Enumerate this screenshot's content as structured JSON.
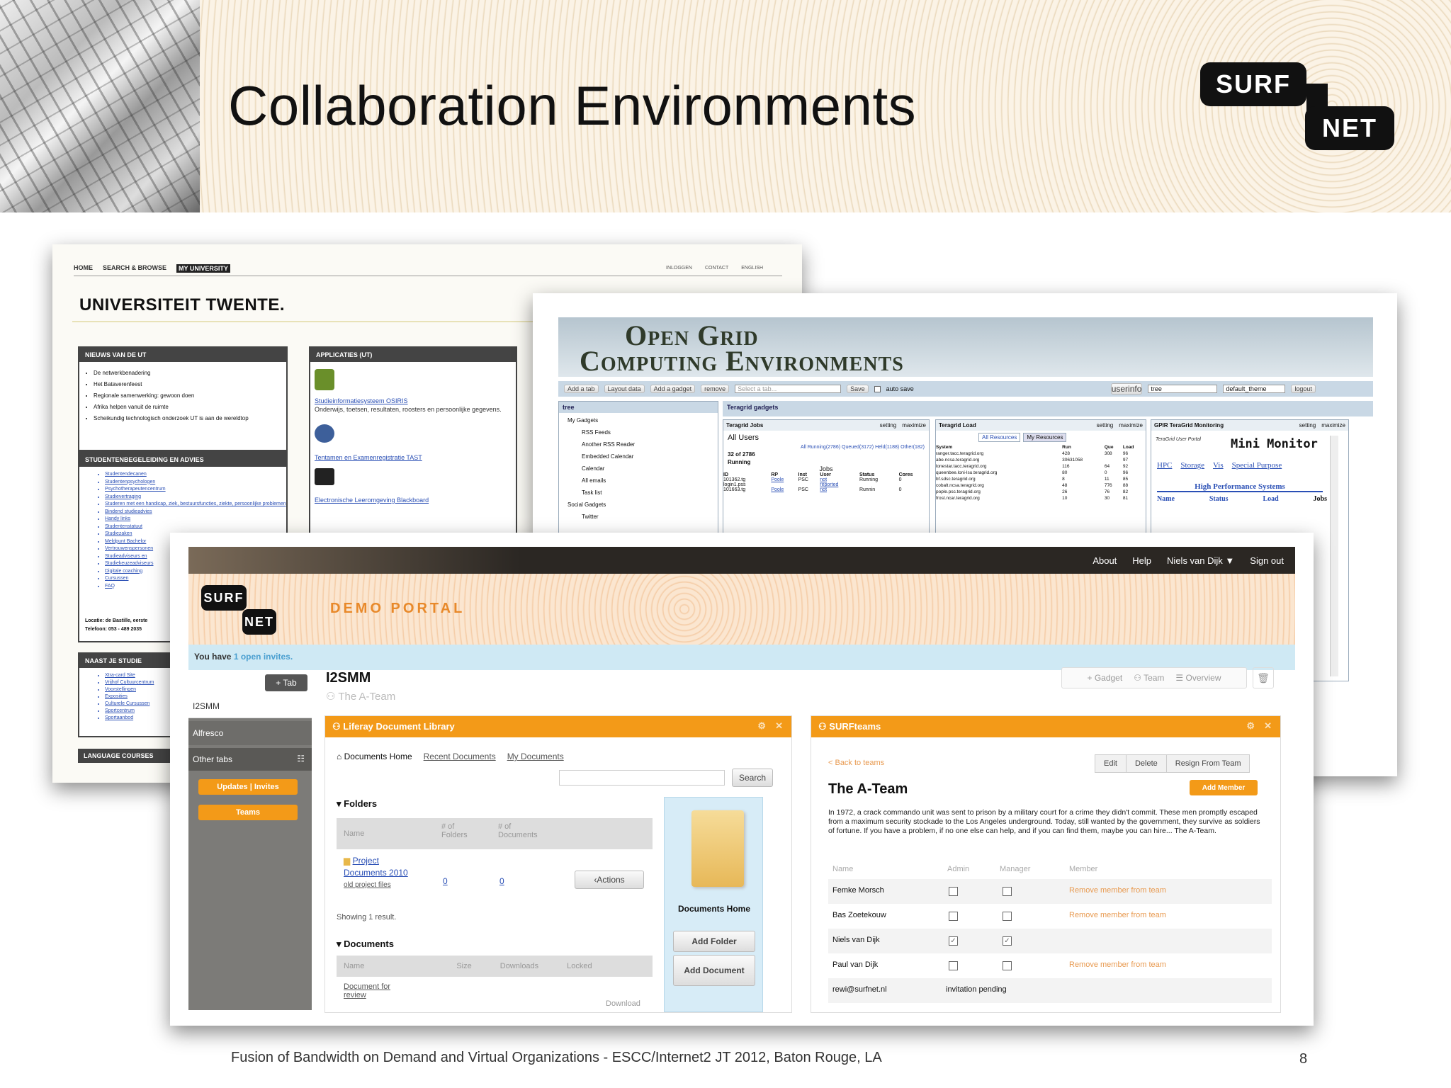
{
  "slide": {
    "title": "Collaboration Environments",
    "footer": "Fusion of Bandwidth on Demand and Virtual Organizations - ESCC/Internet2 JT 2012, Baton Rouge, LA",
    "page_number": "8",
    "logo_top": "SURF",
    "logo_bottom": "NET"
  },
  "twente": {
    "nav": [
      "HOME",
      "SEARCH & BROWSE",
      "MY UNIVERSITY"
    ],
    "nav_right": [
      "INLOGGEN",
      "CONTACT",
      "ENGLISH"
    ],
    "brand": "UNIVERSITEIT TWENTE.",
    "news_title": "NIEUWS VAN DE UT",
    "news": [
      "De netwerkbenadering",
      "Het Bataverenfeest",
      "Regionale samenwerking: gewoon doen",
      "Afrika helpen vanuit de ruimte",
      "Scheikundig technologisch onderzoek UT is aan de wereldtop"
    ],
    "apps_title": "APPLICATIES (UT)",
    "app1_link": "Studieinformatiesysteem OSIRIS",
    "app1_desc": "Onderwijs, toetsen, resultaten, roosters en persoonlijke gegevens.",
    "app2_link": "Tentamen en Examenregistratie TAST",
    "app3_link": "Electronische Leeromgeving Blackboard",
    "study_title": "STUDENTENBEGELEIDING EN ADVIES",
    "study": [
      "Studentendecanen",
      "Studentenpsychologen",
      "Psychotherapeutencentrum",
      "Studievertraging",
      "Studeren met een handicap, ziek, bestuursfuncties, ziekte, persoonlijke problemen",
      "Bindend studieadvies",
      "Handy links",
      "Studentenstatuut",
      "Studiezaken",
      "Meldpunt Bachelor",
      "Vertrouwenspersonen",
      "Studieadviseurs en",
      "Studiekeuzeadviseurs",
      "Digitale coaching",
      "Cursussen",
      "FAQ"
    ],
    "locatie": "Locatie: de Bastille, eerste",
    "telefoon": "Telefoon: 053 - 489 2035",
    "naast_title": "NAAST JE STUDIE",
    "naast": [
      "Xtra-card Site",
      "Vrijhof Cultuurcentrum",
      "Voorstellingen",
      "Exposities",
      "Culturele Cursussen",
      "Sportcentrum",
      "Sportaanbod"
    ],
    "lang_title": "LANGUAGE COURSES"
  },
  "ogce": {
    "brand_line1": "Open Grid",
    "brand_line2": "Computing Environments",
    "toolbar": [
      "Add a tab",
      "Layout data",
      "Add a gadget",
      "remove",
      "Select a tab...",
      "Save",
      "auto save",
      "userinfo",
      "tree",
      "default_theme",
      "logout"
    ],
    "tree_title": "tree",
    "gadgets_title": "Teragrid gadgets",
    "tree": [
      "My Gadgets",
      "RSS Feeds",
      "Another RSS Reader",
      "Embedded Calendar",
      "Calendar",
      "All emails",
      "Task list",
      "Social Gadgets",
      "Twitter"
    ],
    "jobs_title": "Teragrid Jobs",
    "load_title": "Teragrid Load",
    "monitor_title": "GPIR TeraGrid Monitoring",
    "setting": "setting",
    "maximize": "maximize",
    "all_users": "All Users",
    "count": "32 of 2786",
    "running": "Running",
    "jobs": "Jobs",
    "jobs_filter": "All Running(2786) Queued(3172) Held(1188) Other(182)",
    "jobs_cols": [
      "ID",
      "RP",
      "Inst",
      "User",
      "Status",
      "Cores"
    ],
    "jobs_rows": [
      [
        "101362.tg",
        "Poole",
        "PSC",
        "not",
        "Running",
        "0"
      ],
      [
        "login1.pss",
        "",
        "",
        "reported",
        "",
        ""
      ],
      [
        "101663.tg",
        "Poole",
        "PSC",
        "not",
        "Runnin",
        "0"
      ]
    ],
    "load_tabs": [
      "All Resources",
      "My Resources"
    ],
    "load_cols": [
      "System",
      "Run",
      "Que",
      "Load"
    ],
    "load_rows": [
      [
        "ranger.tacc.teragrid.org",
        "428",
        "308",
        "96"
      ],
      [
        "abe.ncsa.teragrid.org",
        "30631058",
        "",
        "97"
      ],
      [
        "lonestar.tacc.teragrid.org",
        "116",
        "64",
        "92"
      ],
      [
        "queenbee.loni-lsu.teragrid.org",
        "80",
        "0",
        "96"
      ],
      [
        "bf.sdsc.teragrid.org",
        "8",
        "11",
        "85"
      ],
      [
        "cobalt.ncsa.teragrid.org",
        "48",
        "776",
        "88"
      ],
      [
        "pople.psc.teragrid.org",
        "26",
        "76",
        "82"
      ],
      [
        "frost.ncar.teragrid.org",
        "10",
        "30",
        "81"
      ]
    ],
    "monitor_brand": "TeraGrid User Portal",
    "mini_monitor": "Mini Monitor",
    "monitor_links": [
      "HPC",
      "Storage",
      "Vis",
      "Special Purpose"
    ],
    "hps": "High Performance Systems",
    "monitor_cols": [
      "Name",
      "Status",
      "Load",
      "Jobs"
    ]
  },
  "portal": {
    "topbar": [
      "About",
      "Help",
      "Niels van Dijk",
      "Sign out"
    ],
    "title": "DEMO PORTAL",
    "invite_pre": "You have",
    "invite_link": "1 open invites.",
    "tab_btn": "+ Tab",
    "side": [
      "I2SMM",
      "Alfresco",
      "Other tabs"
    ],
    "side_btns": [
      "Updates | Invites",
      "Teams"
    ],
    "page_title": "I2SMM",
    "page_sub": "The A-Team",
    "actions": [
      "Gadget",
      "Team",
      "Overview"
    ],
    "doclib_title": "Liferay Document Library",
    "doclib_links": [
      "Documents Home",
      "Recent Documents",
      "My Documents"
    ],
    "search": "Search",
    "folders": "Folders",
    "folder_cols": [
      "Name",
      "# of Folders",
      "# of Documents"
    ],
    "folder_row": {
      "name": "Project Documents 2010",
      "desc": "old project files",
      "folders": "0",
      "docs": "0"
    },
    "actions_btn": "Actions",
    "showing": "Showing 1 result.",
    "documents": "Documents",
    "doc_cols": [
      "Name",
      "Size",
      "Downloads",
      "Locked"
    ],
    "doc_row": "Document for review",
    "download": "Download",
    "docs_home": "Documents Home",
    "add_folder": "Add Folder",
    "add_document": "Add Document",
    "teams_title": "SURFteams",
    "back": "< Back to teams",
    "team_btns": [
      "Edit",
      "Delete",
      "Resign From Team"
    ],
    "team_name": "The A-Team",
    "add_member": "Add Member",
    "team_desc": "In 1972, a crack commando unit was sent to prison by a military court for a crime they didn't commit. These men promptly escaped from a maximum security stockade to the Los Angeles underground. Today, still wanted by the government, they survive as soldiers of fortune. If you have a problem, if no one else can help, and if you can find them, maybe you can hire... The A-Team.",
    "member_cols": [
      "Name",
      "Admin",
      "Manager",
      "Member"
    ],
    "members": [
      {
        "name": "Femke Morsch",
        "admin": false,
        "manager": false,
        "action": "Remove member from team"
      },
      {
        "name": "Bas Zoetekouw",
        "admin": false,
        "manager": false,
        "action": "Remove member from team"
      },
      {
        "name": "Niels van Dijk",
        "admin": true,
        "manager": true,
        "action": ""
      },
      {
        "name": "Paul van Dijk",
        "admin": false,
        "manager": false,
        "action": "Remove member from team"
      }
    ],
    "pending_email": "rewi@surfnet.nl",
    "pending_status": "invitation pending"
  },
  "colors": {
    "accent": "#f39a18",
    "dark": "#111111",
    "link": "#2a4fb5",
    "portal_bar": "#3a3530",
    "invite_bg": "#cfe9f4"
  }
}
